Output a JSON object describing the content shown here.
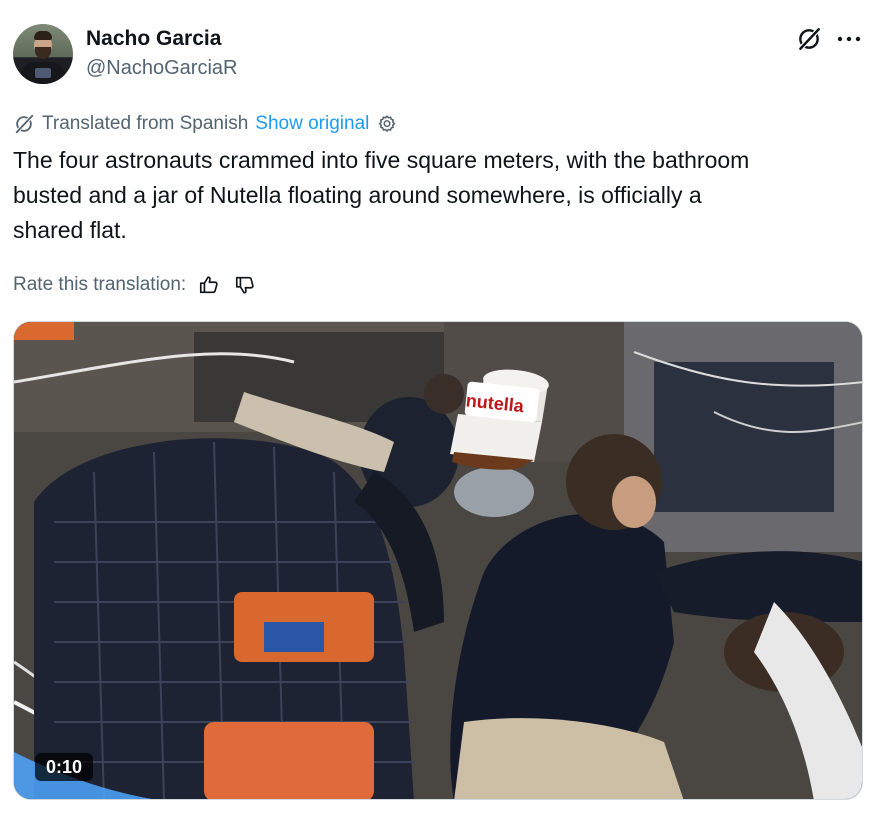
{
  "author": {
    "name": "Nacho Garcia",
    "handle": "@NachoGarciaR"
  },
  "header_icons": [
    "grok-icon",
    "more-icon"
  ],
  "translation": {
    "from_label": "Translated from Spanish",
    "show_original": "Show original"
  },
  "tweet": {
    "text": "The four astronauts crammed into five square meters, with the bathroom\nbusted and a jar of Nutella floating around somewhere, is officially a\nshared flat."
  },
  "rate": {
    "label": "Rate this translation:"
  },
  "video": {
    "duration": "0:10",
    "jar_label": "nutella"
  },
  "colors": {
    "text": "#0f1419",
    "secondary": "#536471",
    "link": "#1d9bf0"
  }
}
